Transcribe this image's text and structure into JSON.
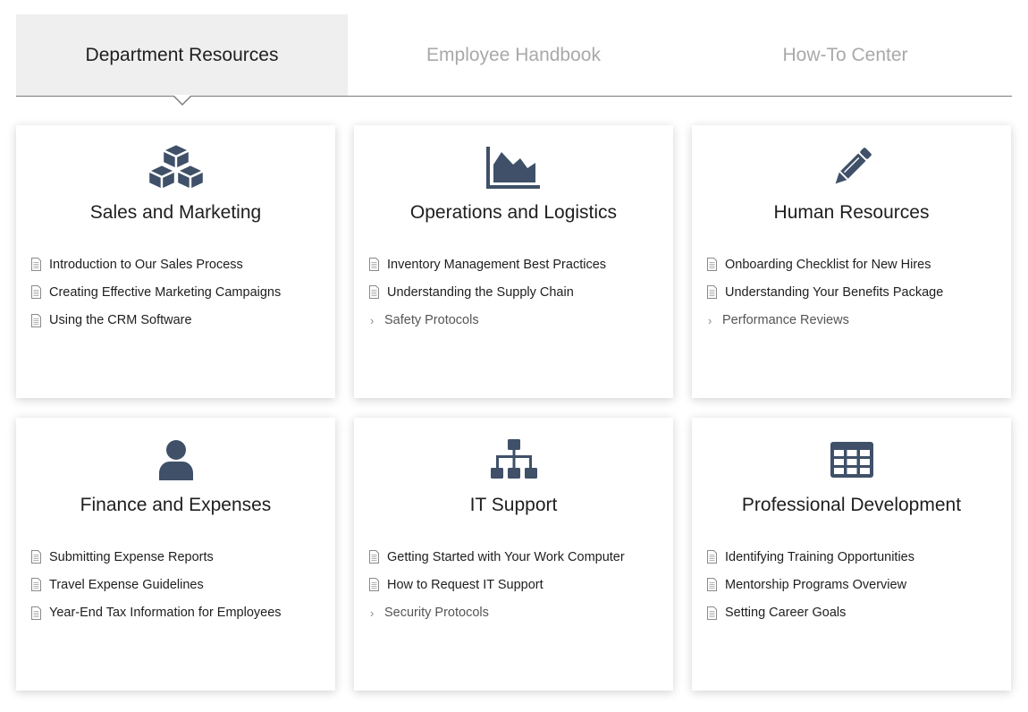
{
  "tabs": [
    {
      "label": "Department Resources",
      "active": true
    },
    {
      "label": "Employee Handbook",
      "active": false
    },
    {
      "label": "How-To Center",
      "active": false
    }
  ],
  "icon_color": "#3f5068",
  "cards": [
    {
      "title": "Sales and Marketing",
      "icon": "cubes-icon",
      "items": [
        {
          "label": "Introduction to Our Sales Process",
          "type": "document"
        },
        {
          "label": "Creating Effective Marketing Campaigns",
          "type": "document"
        },
        {
          "label": "Using the CRM Software",
          "type": "document"
        }
      ]
    },
    {
      "title": "Operations and Logistics",
      "icon": "area-chart-icon",
      "items": [
        {
          "label": "Inventory Management Best Practices",
          "type": "document"
        },
        {
          "label": "Understanding the Supply Chain",
          "type": "document"
        },
        {
          "label": "Safety Protocols",
          "type": "folder"
        }
      ]
    },
    {
      "title": "Human Resources",
      "icon": "pencil-icon",
      "items": [
        {
          "label": "Onboarding Checklist for New Hires",
          "type": "document"
        },
        {
          "label": "Understanding Your Benefits Package",
          "type": "document"
        },
        {
          "label": "Performance Reviews",
          "type": "folder"
        }
      ]
    },
    {
      "title": "Finance and Expenses",
      "icon": "user-icon",
      "items": [
        {
          "label": "Submitting Expense Reports",
          "type": "document"
        },
        {
          "label": "Travel Expense Guidelines",
          "type": "document"
        },
        {
          "label": "Year-End Tax Information for Employees",
          "type": "document"
        }
      ]
    },
    {
      "title": "IT Support",
      "icon": "sitemap-icon",
      "items": [
        {
          "label": "Getting Started with Your Work Computer",
          "type": "document"
        },
        {
          "label": "How to Request IT Support",
          "type": "document"
        },
        {
          "label": "Security Protocols",
          "type": "folder"
        }
      ]
    },
    {
      "title": "Professional Development",
      "icon": "table-icon",
      "items": [
        {
          "label": "Identifying Training Opportunities",
          "type": "document"
        },
        {
          "label": "Mentorship Programs Overview",
          "type": "document"
        },
        {
          "label": "Setting Career Goals",
          "type": "document"
        }
      ]
    }
  ]
}
